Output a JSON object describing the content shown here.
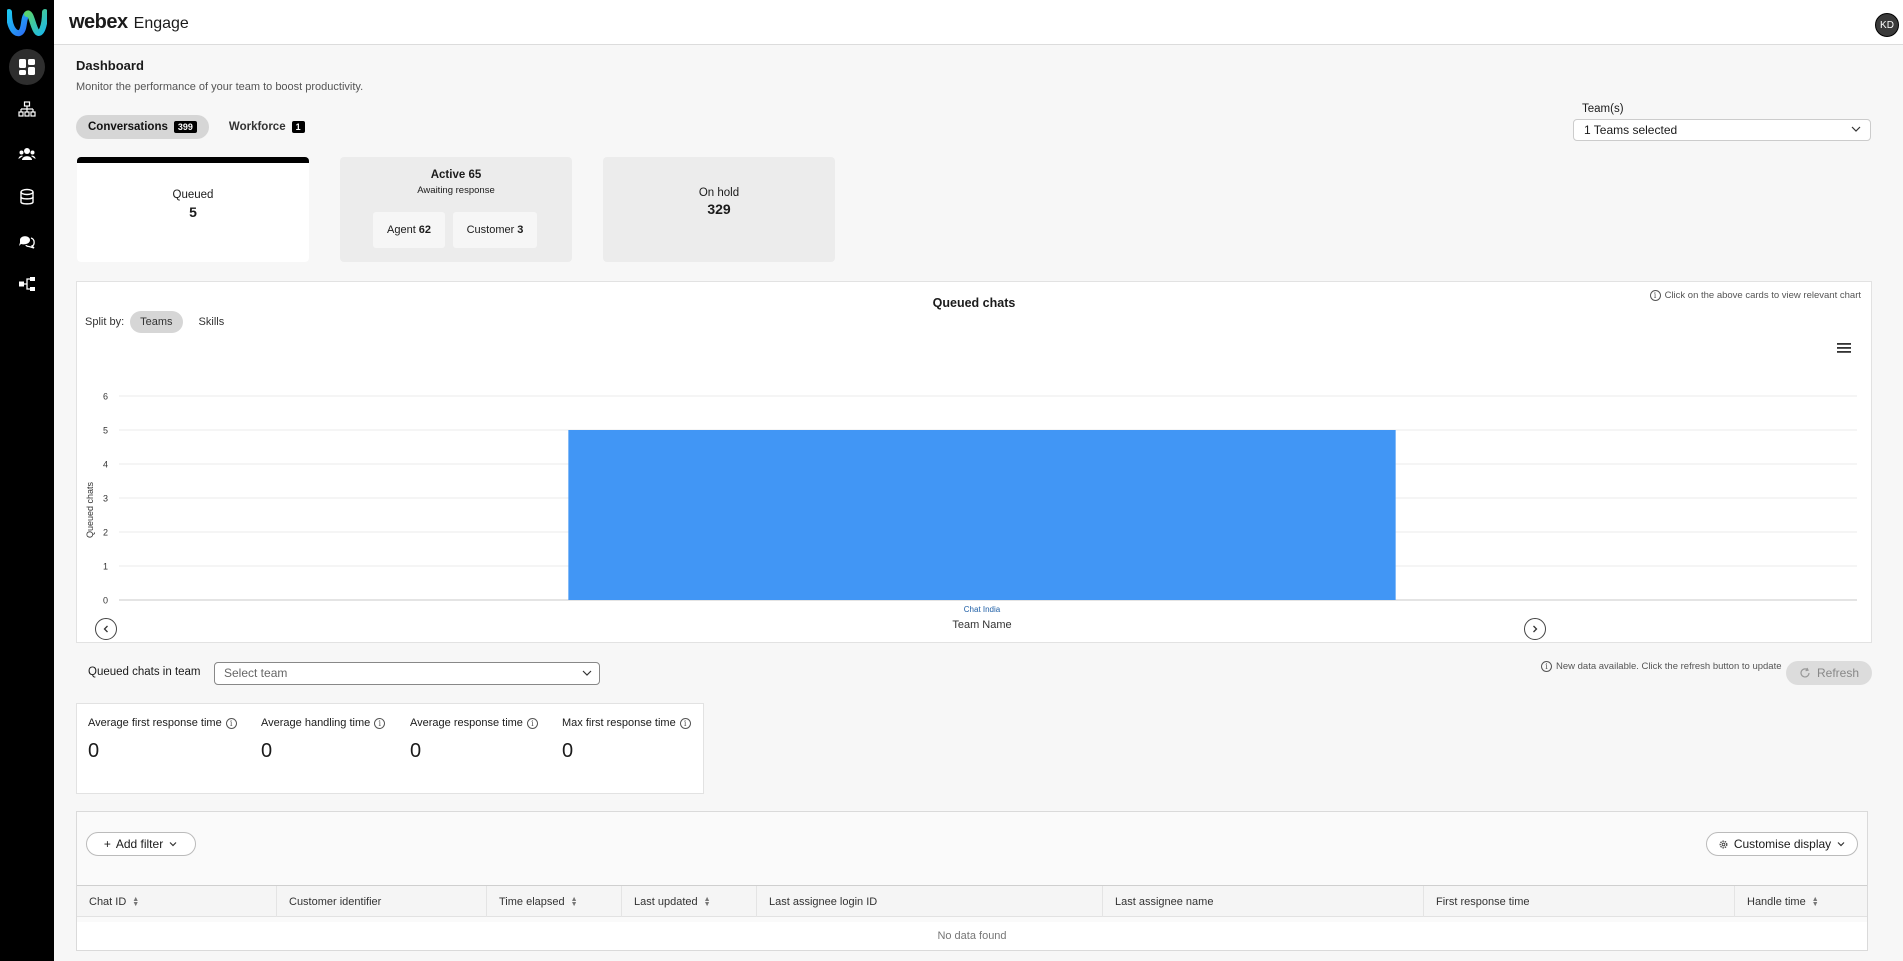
{
  "app": {
    "brand": "webex",
    "product": "Engage",
    "user_initials": "KD"
  },
  "sidebar": {
    "items": [
      {
        "icon": "dashboard-icon",
        "active": true
      },
      {
        "icon": "org-chart-icon",
        "active": false
      },
      {
        "icon": "team-icon",
        "active": false
      },
      {
        "icon": "database-icon",
        "active": false
      },
      {
        "icon": "chat-bubbles-icon",
        "active": false
      },
      {
        "icon": "workflow-icon",
        "active": false
      }
    ]
  },
  "page": {
    "title": "Dashboard",
    "subtitle": "Monitor the performance of your team to boost productivity."
  },
  "tabs": [
    {
      "label": "Conversations",
      "count": "399",
      "active": true
    },
    {
      "label": "Workforce",
      "count": "1",
      "active": false
    }
  ],
  "teams_filter": {
    "label": "Team(s)",
    "value": "1 Teams selected"
  },
  "cards": {
    "queued": {
      "label": "Queued",
      "value": "5"
    },
    "active": {
      "label": "Active 65",
      "sub": "Awaiting response",
      "agent_label": "Agent",
      "agent_value": "62",
      "customer_label": "Customer",
      "customer_value": "3"
    },
    "hold": {
      "label": "On hold",
      "value": "329"
    }
  },
  "chart_panel": {
    "hint": "Click on the above cards to view relevant chart",
    "split_label": "Split by:",
    "split_options": [
      "Teams",
      "Skills"
    ]
  },
  "chart_data": {
    "type": "bar",
    "title": "Queued chats",
    "categories": [
      "Chat India"
    ],
    "values": [
      5
    ],
    "xlabel": "Team Name",
    "ylabel": "Queued chats",
    "ylim": [
      0,
      6
    ],
    "yticks": [
      0,
      1,
      2,
      3,
      4,
      5,
      6
    ],
    "grid": true,
    "color": "#4196f5"
  },
  "team_filter": {
    "label": "Queued chats in team",
    "placeholder": "Select team"
  },
  "refresh": {
    "hint": "New data available. Click the refresh button to update",
    "label": "Refresh"
  },
  "metrics": [
    {
      "label": "Average first response time",
      "value": "0"
    },
    {
      "label": "Average handling time",
      "value": "0"
    },
    {
      "label": "Average response time",
      "value": "0"
    },
    {
      "label": "Max first response time",
      "value": "0"
    }
  ],
  "table": {
    "add_filter": "Add filter",
    "customise": "Customise display",
    "columns": [
      {
        "label": "Chat ID",
        "sortable": true
      },
      {
        "label": "Customer identifier",
        "sortable": false
      },
      {
        "label": "Time elapsed",
        "sortable": true
      },
      {
        "label": "Last updated",
        "sortable": true
      },
      {
        "label": "Last assignee login ID",
        "sortable": false
      },
      {
        "label": "Last assignee name",
        "sortable": false
      },
      {
        "label": "First response time",
        "sortable": false
      },
      {
        "label": "Handle time",
        "sortable": true
      }
    ],
    "empty_text": "No data found"
  }
}
